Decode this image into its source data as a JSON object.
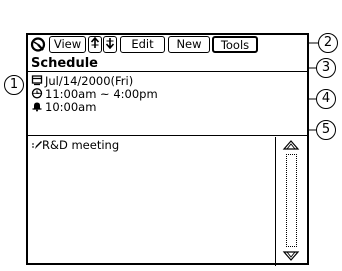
{
  "toolbar": {
    "view_label": "View",
    "up_label": "↑",
    "down_label": "↓",
    "edit_label": "Edit",
    "new_label": "New",
    "tools_label": "Tools"
  },
  "screen_title": "Schedule",
  "entry": {
    "date": "Jul/14/2000(Fri)",
    "time": "11:00am ~  4:00pm",
    "alarm": "10:00am",
    "memo": "R&D  meeting"
  },
  "callouts": {
    "one": "1",
    "two": "2",
    "three": "3",
    "four": "4",
    "five": "5"
  },
  "icons": {
    "logo": "app-logo-icon",
    "date": "calendar-icon",
    "time": "clock-icon",
    "alarm": "bell-icon",
    "memo": "pencil-icon",
    "scroll_up": "scroll-up-arrow-icon",
    "scroll_down": "scroll-down-arrow-icon"
  }
}
